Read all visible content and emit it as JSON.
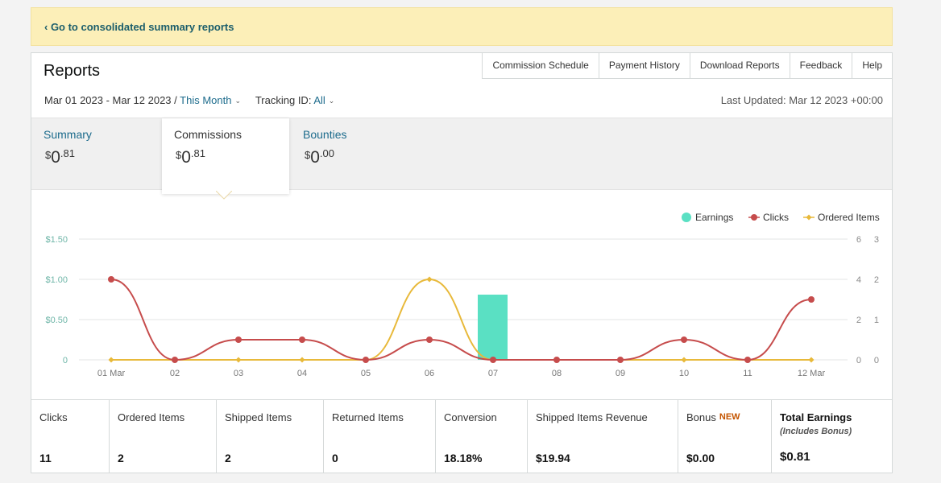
{
  "banner": {
    "link": "‹ Go to consolidated summary reports"
  },
  "header": {
    "title": "Reports",
    "links": [
      "Commission Schedule",
      "Payment History",
      "Download Reports",
      "Feedback",
      "Help"
    ]
  },
  "filters": {
    "date_range": "Mar 01 2023 - Mar 12 2023 /",
    "period": "This Month",
    "tracking_label": "Tracking ID:",
    "tracking_value": "All",
    "last_updated": "Last Updated: Mar 12 2023 +00:00"
  },
  "tabs": [
    {
      "label": "Summary",
      "dollar": "$",
      "whole": "0",
      "cents": ".81"
    },
    {
      "label": "Commissions",
      "dollar": "$",
      "whole": "0",
      "cents": ".81"
    },
    {
      "label": "Bounties",
      "dollar": "$",
      "whole": "0",
      "cents": ".00"
    }
  ],
  "chart_data": {
    "type": "line",
    "categories": [
      "01 Mar",
      "02",
      "03",
      "04",
      "05",
      "06",
      "07",
      "08",
      "09",
      "10",
      "11",
      "12 Mar"
    ],
    "y_left_ticks": [
      "0",
      "$0.50",
      "$1.00",
      "$1.50"
    ],
    "y_right_ticks_a": [
      "0",
      "2",
      "4",
      "6"
    ],
    "y_right_ticks_b": [
      "0",
      "1",
      "2",
      "3"
    ],
    "ylim_left": [
      0,
      1.5
    ],
    "legend": [
      "Earnings",
      "Clicks",
      "Ordered Items"
    ],
    "legend_position": "top-right",
    "series": [
      {
        "name": "Earnings",
        "kind": "bar",
        "color": "#5ae0c3",
        "values": [
          0,
          0,
          0,
          0,
          0,
          0,
          0.81,
          0,
          0,
          0,
          0,
          0
        ]
      },
      {
        "name": "Clicks",
        "kind": "line",
        "color": "#c64c4c",
        "values": [
          4,
          0,
          1,
          1,
          0,
          1,
          0,
          0,
          0,
          1,
          0,
          3
        ]
      },
      {
        "name": "Ordered Items",
        "kind": "line",
        "color": "#e8b93a",
        "values": [
          0,
          0,
          0,
          0,
          0,
          2,
          0,
          0,
          0,
          0,
          0,
          0
        ]
      }
    ]
  },
  "metrics": [
    {
      "label": "Clicks",
      "value": "11"
    },
    {
      "label": "Ordered Items",
      "value": "2"
    },
    {
      "label": "Shipped Items",
      "value": "2"
    },
    {
      "label": "Returned Items",
      "value": "0"
    },
    {
      "label": "Conversion",
      "value": "18.18%"
    },
    {
      "label": "Shipped Items Revenue",
      "value": "$19.94"
    },
    {
      "label": "Bonus",
      "badge": "NEW",
      "value": "$0.00"
    },
    {
      "label": "Total Earnings",
      "sub": "(Includes Bonus)",
      "value": "$0.81"
    }
  ]
}
